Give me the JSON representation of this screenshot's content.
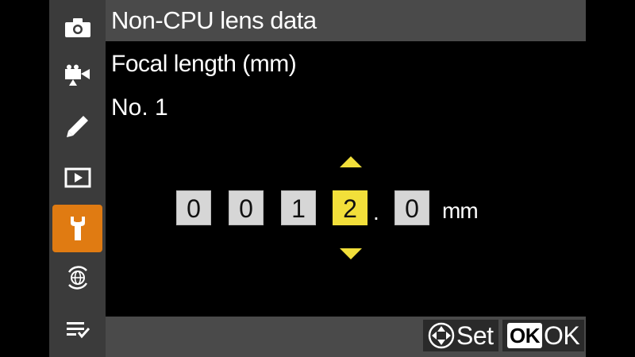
{
  "header": {
    "title": "Non-CPU lens data"
  },
  "subtitle": "Focal length (mm)",
  "lens_number": "No. 1",
  "entry": {
    "digits": [
      "0",
      "0",
      "1",
      "2",
      "0"
    ],
    "selected_index": 3,
    "decimal_point": ".",
    "unit": "mm"
  },
  "footer": {
    "set_label": "Set",
    "ok_badge": "OK",
    "ok_label": "OK"
  },
  "sidebar": {
    "items": [
      {
        "icon": "camera-icon"
      },
      {
        "icon": "movie-camera-icon"
      },
      {
        "icon": "pencil-icon"
      },
      {
        "icon": "playback-icon"
      },
      {
        "icon": "wrench-icon",
        "active": true
      },
      {
        "icon": "network-icon"
      },
      {
        "icon": "my-menu-icon"
      }
    ]
  },
  "colors": {
    "background": "#000000",
    "sidebar": "#3b3b3b",
    "header_bar": "#4a4a4a",
    "active_tab": "#e07b12",
    "selected_digit": "#f2df3a",
    "digit_box": "#d6d6d6",
    "arrow": "#f2df3a"
  }
}
